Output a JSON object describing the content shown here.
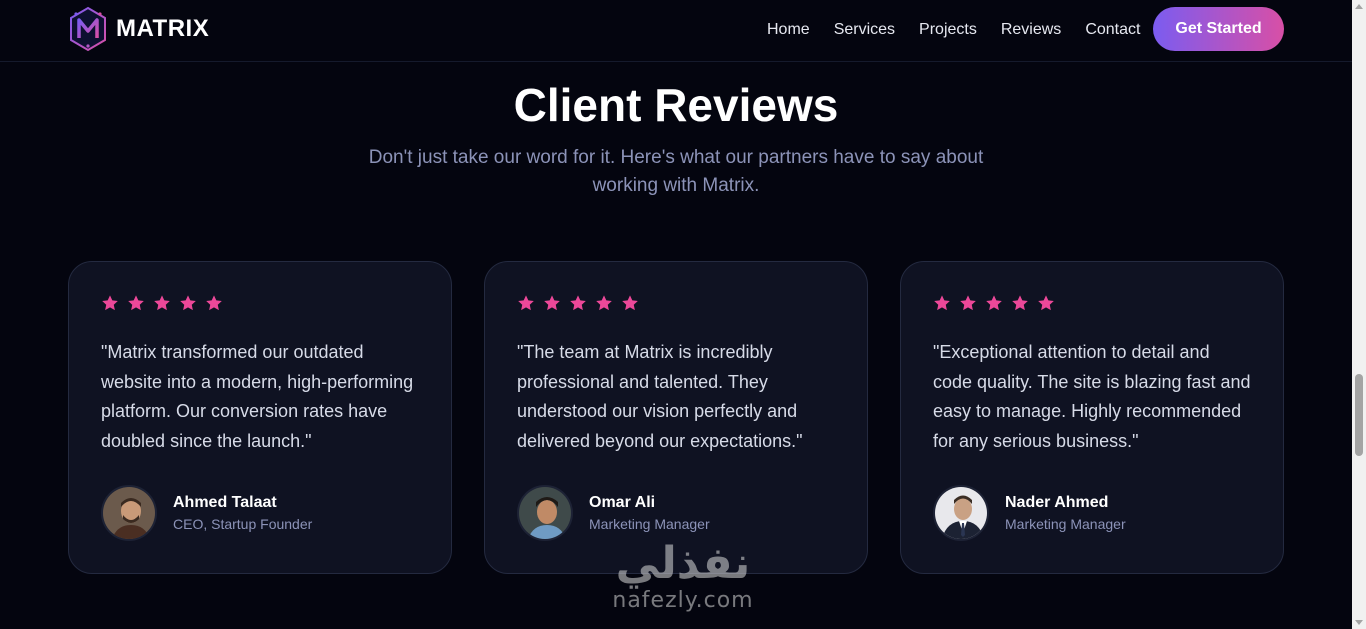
{
  "nav": {
    "brand": "MATRIX",
    "links": [
      "Home",
      "Services",
      "Projects",
      "Reviews",
      "Contact"
    ],
    "cta_label": "Get Started"
  },
  "section": {
    "title": "Client Reviews",
    "subtitle": "Don't just take our word for it. Here's what our partners have to say about working with Matrix."
  },
  "reviews": [
    {
      "rating": 5,
      "quote": "\"Matrix transformed our outdated website into a modern, high-performing platform. Our conversion rates have doubled since the launch.\"",
      "name": "Ahmed Talaat",
      "role": "CEO, Startup Founder"
    },
    {
      "rating": 5,
      "quote": "\"The team at Matrix is incredibly professional and talented. They understood our vision perfectly and delivered beyond our expectations.\"",
      "name": "Omar Ali",
      "role": "Marketing Manager"
    },
    {
      "rating": 5,
      "quote": "\"Exceptional attention to detail and code quality. The site is blazing fast and easy to manage. Highly recommended for any serious business.\"",
      "name": "Nader Ahmed",
      "role": "Marketing Manager"
    }
  ],
  "watermark": {
    "arabic": "نفذلي",
    "latin": "nafezly.com"
  },
  "colors": {
    "background": "#04050f",
    "card": "#0f1222",
    "star": "#ec4899",
    "accent_start": "#7b5cf0",
    "accent_end": "#d84fa6",
    "muted_text": "#8c93b8"
  },
  "icons": {
    "logo": "matrix-logo-icon",
    "star": "star-icon",
    "avatar": "avatar-photo"
  }
}
